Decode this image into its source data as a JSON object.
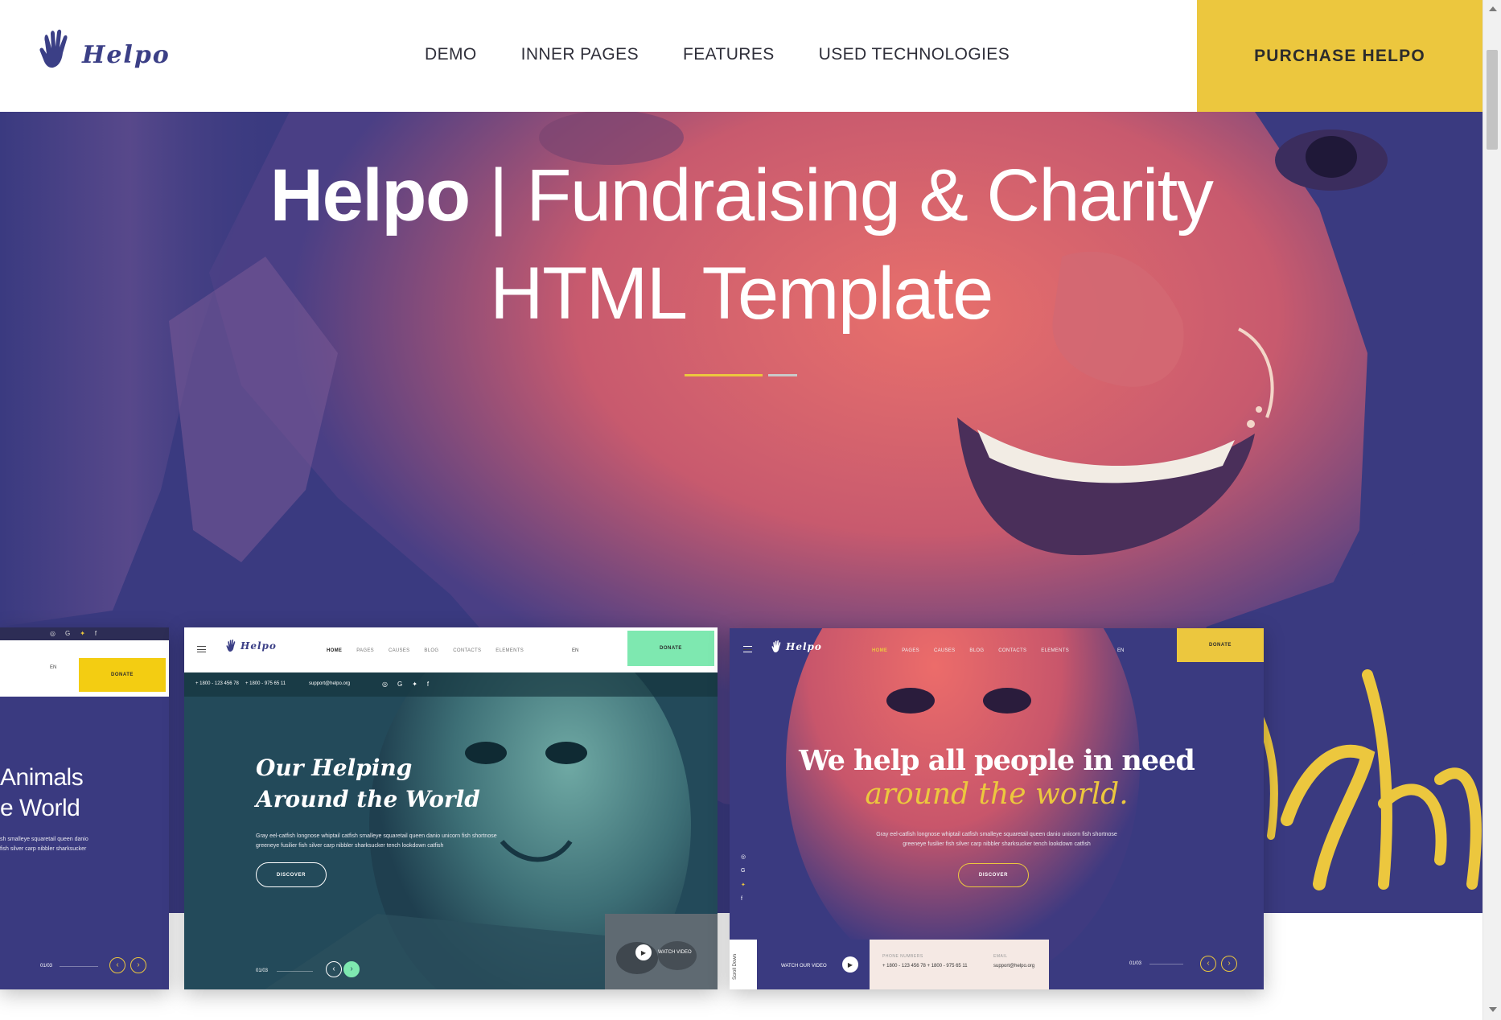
{
  "header": {
    "logo_text": "Helpo",
    "nav": [
      "DEMO",
      "INNER PAGES",
      "FEATURES",
      "USED TECHNOLOGIES"
    ],
    "purchase_label": "PURCHASE HELPO"
  },
  "hero": {
    "title_brand": "Helpo",
    "title_separator": " | ",
    "title_rest": "Fundraising & Charity",
    "title_line2": "HTML Template",
    "accent_yellow": "#ecc73e",
    "bg_purple": "#3a3a80",
    "bg_coral": "#e0646a"
  },
  "cards": {
    "left": {
      "lang": "EN",
      "donate": "DONATE",
      "heading_line1": "Animals",
      "heading_line2": "e World",
      "body_line1": "sh smalleye squaretail queen danio",
      "body_line2": "fish silver carp nibbler sharksucker",
      "counter": "01/03"
    },
    "middle": {
      "logo_text": "Helpo",
      "nav": [
        "HOME",
        "PAGES",
        "CAUSES",
        "BLOG",
        "CONTACTS",
        "ELEMENTS"
      ],
      "lang": "EN",
      "donate": "DONATE",
      "phone1": "+ 1800 - 123 456 78",
      "phone2": "+ 1800 - 975 65 11",
      "email": "support@helpo.org",
      "heading_line1": "Our Helping",
      "heading_line2": "Around the World",
      "body_line1": "Gray eel-catfish longnose whiptail catfish smalleye squaretail queen danio unicorn fish shortnose",
      "body_line2": "greeneye fusilier fish silver carp nibbler sharksucker tench lookdown catfish",
      "discover": "DISCOVER",
      "watch_video": "WATCH VIDEO",
      "counter": "01/03",
      "donate_color": "#7ee8b0"
    },
    "right": {
      "logo_text": "Helpo",
      "nav": [
        "HOME",
        "PAGES",
        "CAUSES",
        "BLOG",
        "CONTACTS",
        "ELEMENTS"
      ],
      "lang": "EN",
      "donate": "DONATE",
      "heading_line1": "We help all people in need",
      "heading_line2": "around the world.",
      "body_line1": "Gray eel-catfish longnose whiptail catfish smalleye squaretail queen danio unicorn fish shortnose",
      "body_line2": "greeneye fusilier fish silver carp nibbler sharksucker tench lookdown catfish",
      "discover": "DISCOVER",
      "scroll_down": "Scroll Down",
      "watch_video": "WATCH OUR VIDEO",
      "phone_label": "PHONE NUMBERS",
      "phones": "+ 1800 - 123 456 78   + 1800 - 975 65 11",
      "email_label": "EMAIL",
      "email": "support@helpo.org",
      "counter": "01/03"
    }
  }
}
